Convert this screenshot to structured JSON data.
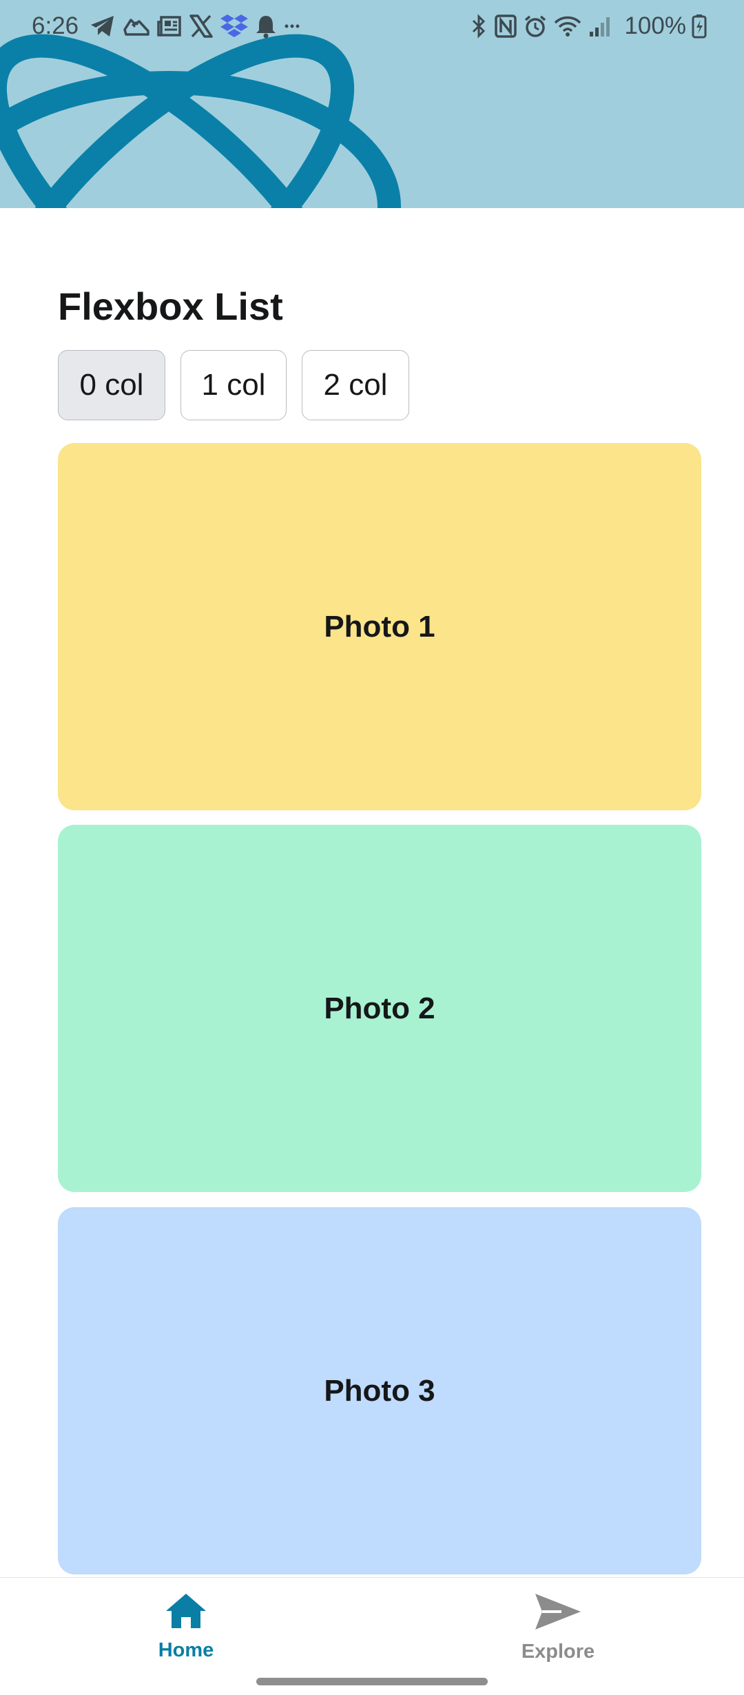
{
  "status_bar": {
    "time": "6:26",
    "battery": "100%",
    "notification_icons": [
      "telegram-icon",
      "shoe-icon",
      "news-icon",
      "x-icon",
      "dropbox-icon",
      "bell-icon",
      "more-icon"
    ],
    "system_icons": [
      "bluetooth-icon",
      "nfc-icon",
      "alarm-icon",
      "wifi-icon",
      "signal-icon",
      "battery-icon"
    ]
  },
  "header": {
    "background": "#a1cedc",
    "logo": "react-logo",
    "accent": "#0a80a8"
  },
  "main": {
    "title": "Flexbox List",
    "column_options": [
      {
        "label": "0 col",
        "selected": true
      },
      {
        "label": "1 col",
        "selected": false
      },
      {
        "label": "2 col",
        "selected": false
      }
    ],
    "photos": [
      {
        "label": "Photo 1",
        "color": "#fbe48a"
      },
      {
        "label": "Photo 2",
        "color": "#a8f2d2"
      },
      {
        "label": "Photo 3",
        "color": "#bfdbfd"
      }
    ]
  },
  "tab_bar": {
    "active_color": "#0a7ea4",
    "inactive_color": "#8c8c8c",
    "tabs": [
      {
        "label": "Home",
        "icon": "house-icon",
        "active": true
      },
      {
        "label": "Explore",
        "icon": "paper-plane-icon",
        "active": false
      }
    ]
  }
}
